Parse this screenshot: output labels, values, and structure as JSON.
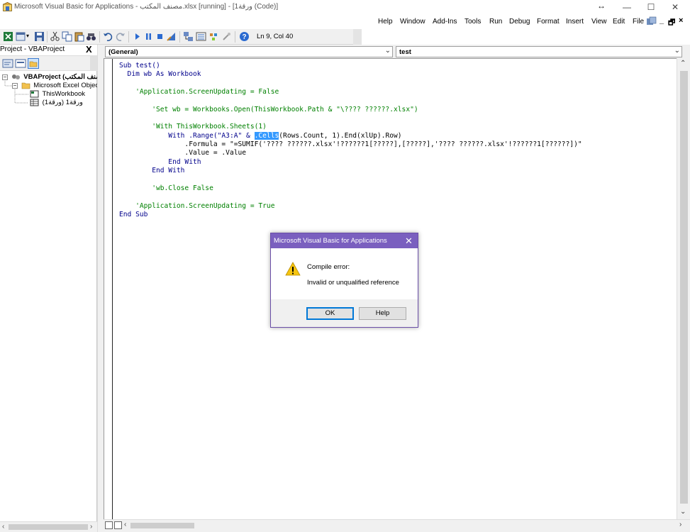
{
  "window": {
    "title": "Microsoft Visual Basic for Applications - مصنف المكتب.xlsx [running] - [ورقة1 (Code)]",
    "resize_glyph": "↔",
    "minimize": "—",
    "maximize": "☐",
    "close": "✕"
  },
  "menu": {
    "items": [
      "Help",
      "Window",
      "Add-Ins",
      "Tools",
      "Run",
      "Debug",
      "Format",
      "Insert",
      "View",
      "Edit",
      "File"
    ],
    "mdi_minimize": "_",
    "mdi_restore": "🗗",
    "mdi_close": "×"
  },
  "toolbar": {
    "status": "Ln 9, Col 40"
  },
  "project": {
    "title": "Project - VBAProject",
    "close": "X",
    "tree": {
      "root": "VBAProject (مصنف المكتب",
      "folder": "Microsoft Excel Objects",
      "item1": "ThisWorkbook",
      "item2": "ورقة1 (ورقة1)"
    }
  },
  "code_window": {
    "object_combo": "(General)",
    "proc_combo": "test",
    "lines": {
      "l1": "Sub test()",
      "l2": "  Dim wb As Workbook",
      "l3": "    'Application.ScreenUpdating = False",
      "l4": "        'Set wb = Workbooks.Open(ThisWorkbook.Path & \"\\???? ??????.xlsx\")",
      "l5": "        'With ThisWorkbook.Sheets(1)",
      "l6a": "            With .Range(\"A3:A\" & ",
      "l6sel": ".Cells",
      "l6b": "(Rows.Count, 1).End(xlUp).Row)",
      "l7": "                .Formula = \"=SUMIF('???? ??????.xlsx'!??????1[?????],[?????],'???? ??????.xlsx'!??????1[??????])\"",
      "l8": "                .Value = .Value",
      "l9": "            End With",
      "l10": "        End With",
      "l11": "        'wb.Close False",
      "l12": "    'Application.ScreenUpdating = True",
      "l13": "End Sub"
    }
  },
  "dialog": {
    "title": "Microsoft Visual Basic for Applications",
    "close": "✕",
    "line1": "Compile error:",
    "line2": "Invalid or unqualified reference",
    "ok": "OK",
    "help": "Help"
  },
  "colors": {
    "dialog_title": "#7a5fbf",
    "keyword": "#00008b",
    "comment": "#008000",
    "selection": "#3399ff"
  }
}
